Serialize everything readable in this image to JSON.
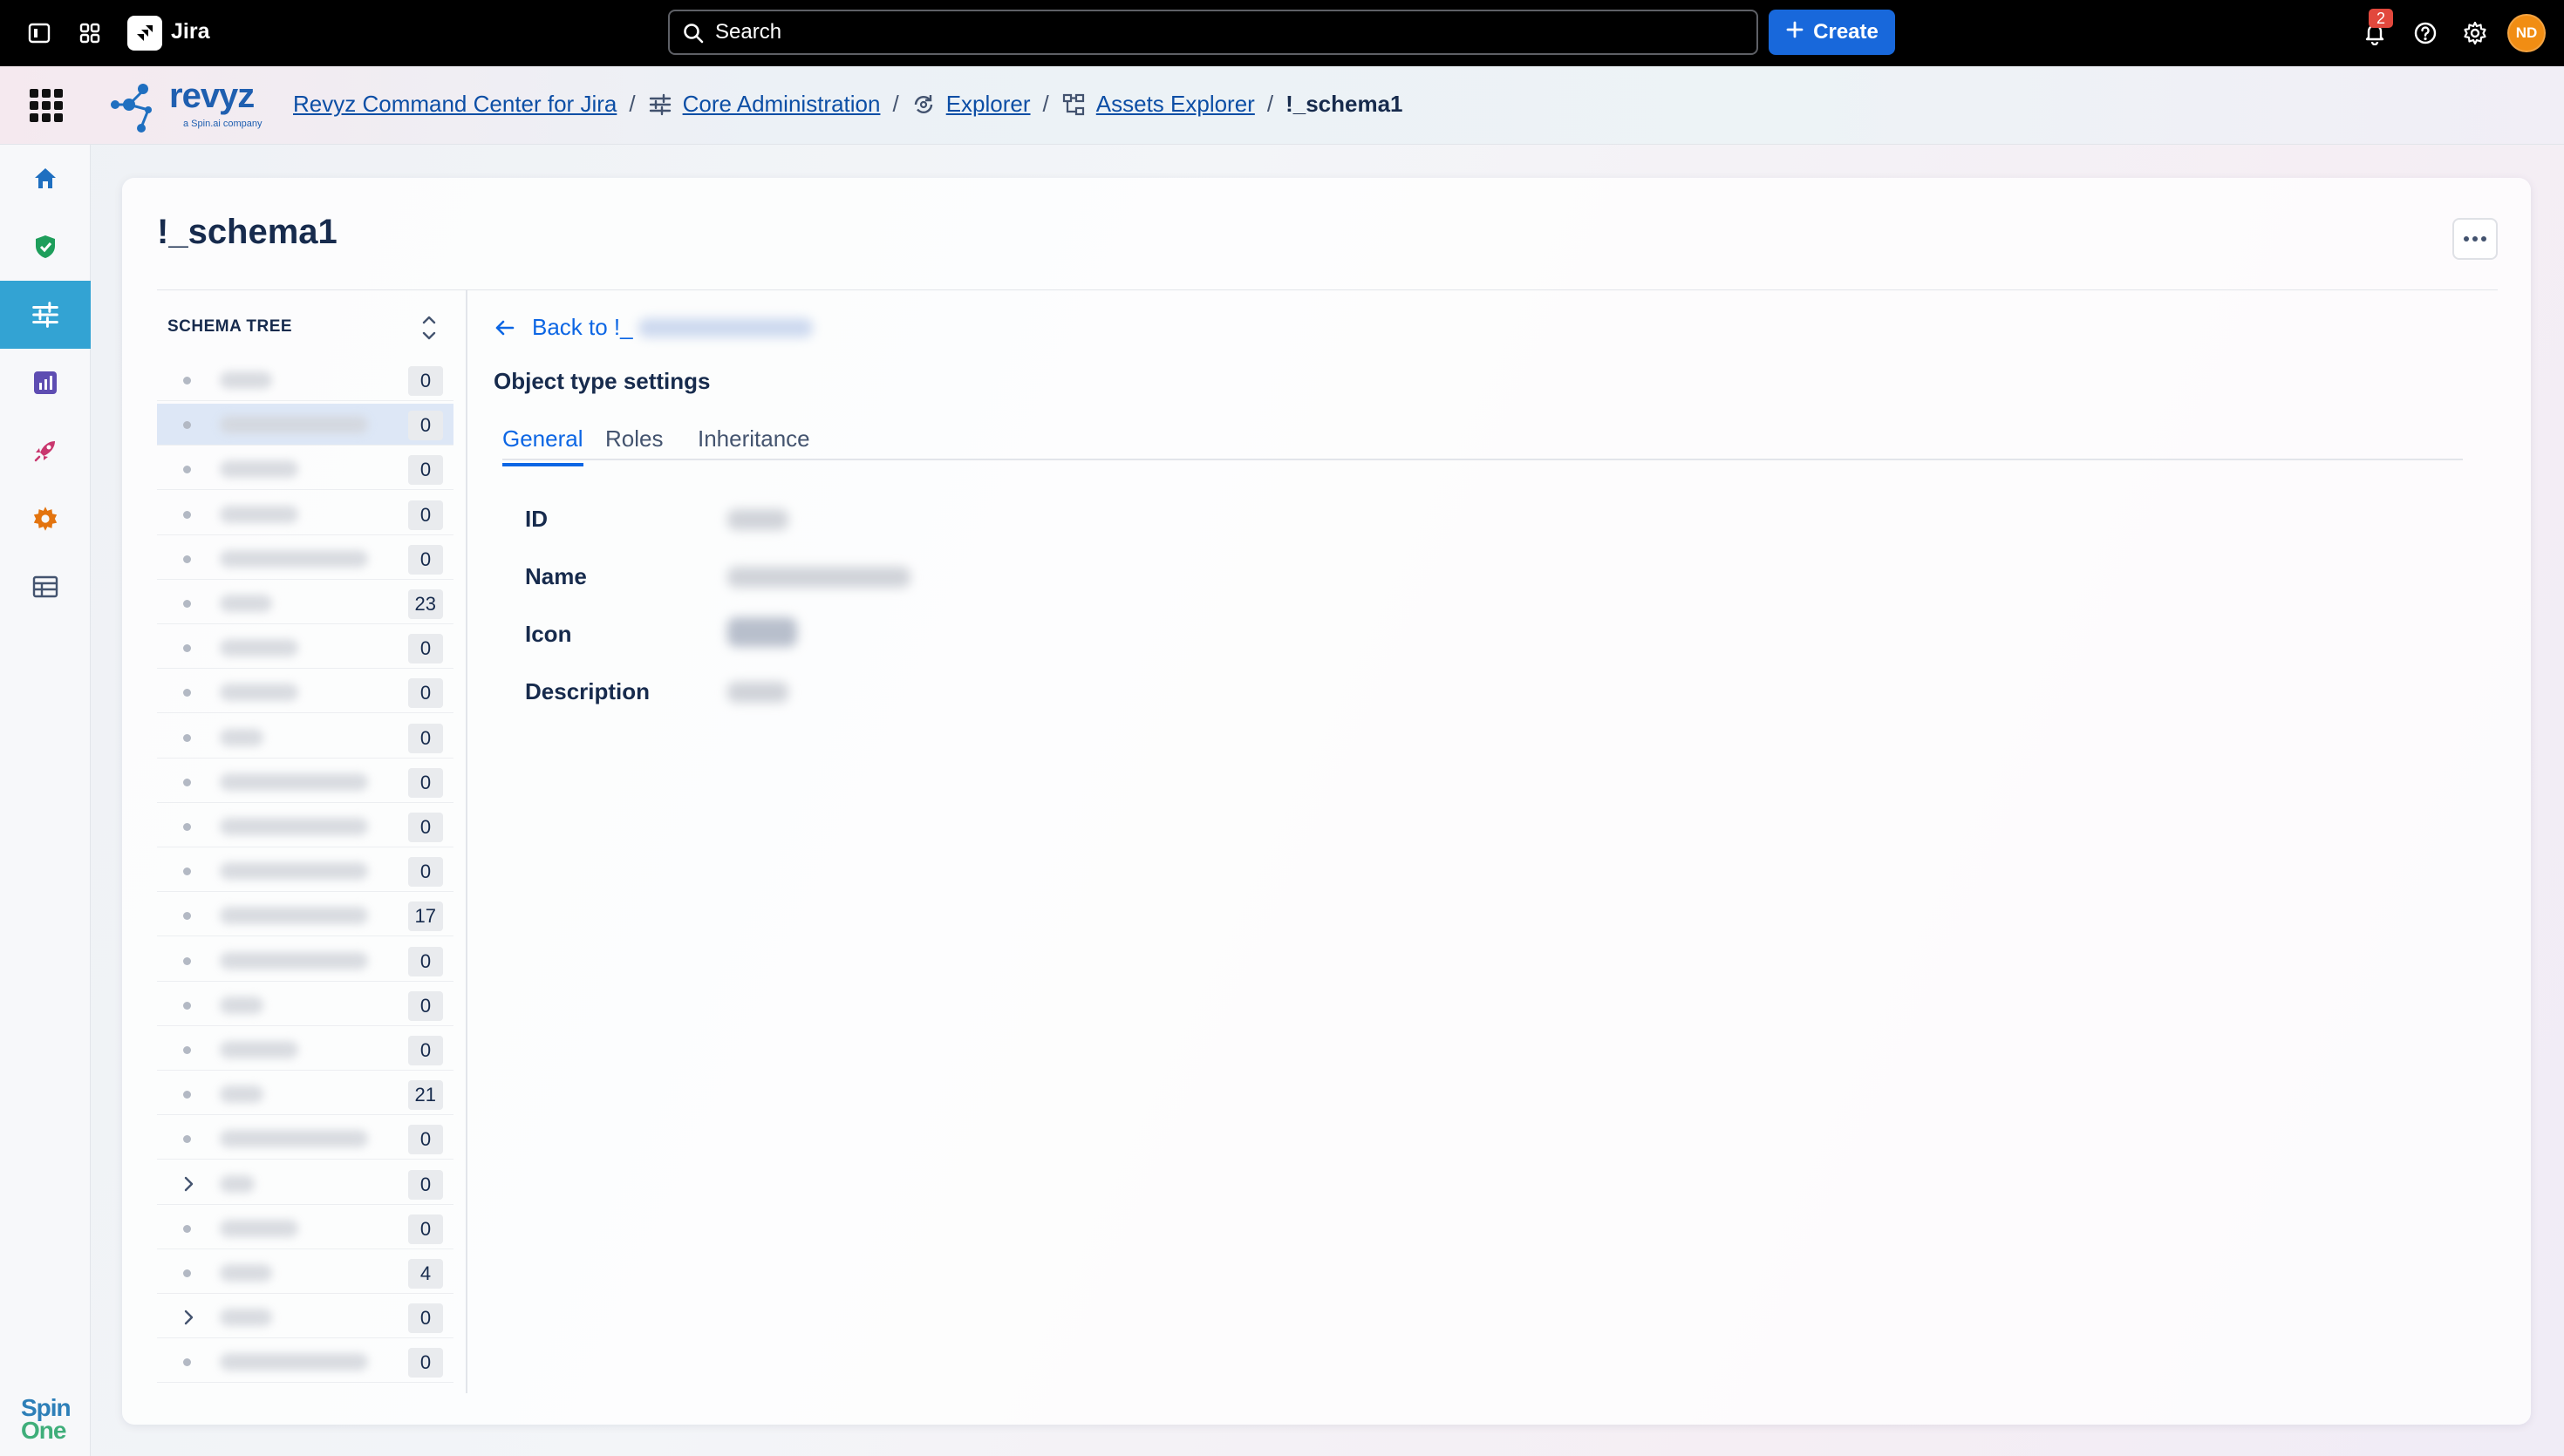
{
  "topbar": {
    "app_name": "Jira",
    "search_label": "Search",
    "create_label": "Create",
    "notification_count": "2",
    "avatar_initials": "ND"
  },
  "breadcrumb": {
    "items": [
      {
        "label": "Revyz Command Center for Jira"
      },
      {
        "label": "Core Administration"
      },
      {
        "label": "Explorer"
      },
      {
        "label": "Assets Explorer"
      }
    ],
    "current": "!_schema1",
    "separator": "/"
  },
  "brand": {
    "logo_text": "revyz",
    "logo_subtext": "a Spin.ai company",
    "footer_logo_line1": "Spin",
    "footer_logo_line2": "One"
  },
  "page": {
    "title": "!_schema1"
  },
  "schema_tree": {
    "header": "SCHEMA TREE",
    "rows": [
      {
        "count": "0",
        "expandable": false,
        "selected": false
      },
      {
        "count": "0",
        "expandable": false,
        "selected": true
      },
      {
        "count": "0",
        "expandable": false,
        "selected": false
      },
      {
        "count": "0",
        "expandable": false,
        "selected": false
      },
      {
        "count": "0",
        "expandable": false,
        "selected": false
      },
      {
        "count": "23",
        "expandable": false,
        "selected": false
      },
      {
        "count": "0",
        "expandable": false,
        "selected": false
      },
      {
        "count": "0",
        "expandable": false,
        "selected": false
      },
      {
        "count": "0",
        "expandable": false,
        "selected": false
      },
      {
        "count": "0",
        "expandable": false,
        "selected": false
      },
      {
        "count": "0",
        "expandable": false,
        "selected": false
      },
      {
        "count": "0",
        "expandable": false,
        "selected": false
      },
      {
        "count": "17",
        "expandable": false,
        "selected": false
      },
      {
        "count": "0",
        "expandable": false,
        "selected": false
      },
      {
        "count": "0",
        "expandable": false,
        "selected": false
      },
      {
        "count": "0",
        "expandable": false,
        "selected": false
      },
      {
        "count": "21",
        "expandable": false,
        "selected": false
      },
      {
        "count": "0",
        "expandable": false,
        "selected": false
      },
      {
        "count": "0",
        "expandable": true,
        "selected": false
      },
      {
        "count": "0",
        "expandable": false,
        "selected": false
      },
      {
        "count": "4",
        "expandable": false,
        "selected": false
      },
      {
        "count": "0",
        "expandable": true,
        "selected": false
      },
      {
        "count": "0",
        "expandable": false,
        "selected": false
      }
    ]
  },
  "content": {
    "back_label": "Back to !_",
    "section_title": "Object type settings",
    "tabs": [
      {
        "label": "General",
        "active": true
      },
      {
        "label": "Roles",
        "active": false
      },
      {
        "label": "Inheritance",
        "active": false
      }
    ],
    "fields": [
      {
        "label": "ID"
      },
      {
        "label": "Name"
      },
      {
        "label": "Icon"
      },
      {
        "label": "Description"
      }
    ]
  },
  "colors": {
    "accent": "#0c66e4",
    "create_button": "#1868db",
    "rail_active": "#33a3d3",
    "avatar": "#f18d13",
    "notification_badge": "#e2483d"
  }
}
